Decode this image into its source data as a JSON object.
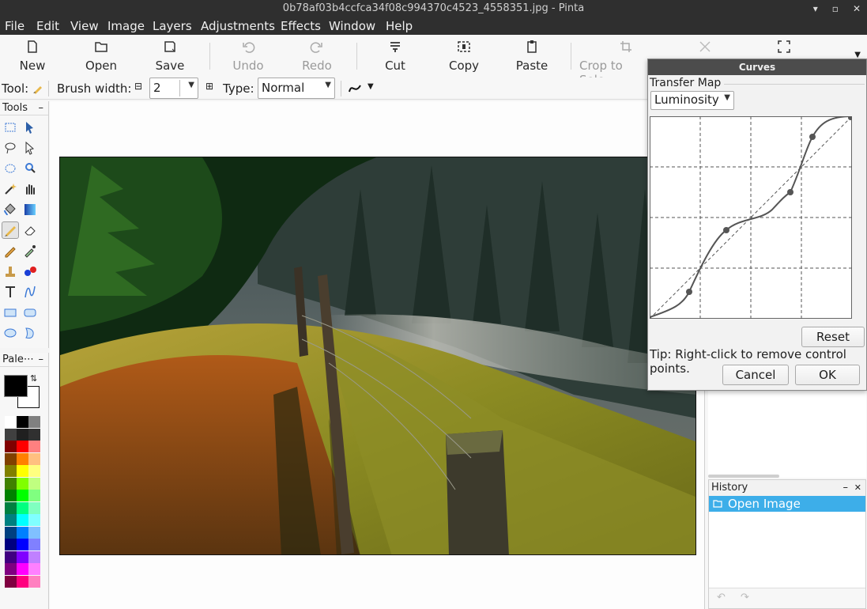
{
  "window": {
    "title": "0b78af03b4ccfca34f08c994370c4523_4558351.jpg - Pinta"
  },
  "menu": [
    {
      "label": "File"
    },
    {
      "label": "Edit"
    },
    {
      "label": "View"
    },
    {
      "label": "Image"
    },
    {
      "label": "Layers"
    },
    {
      "label": "Adjustments"
    },
    {
      "label": "Effects"
    },
    {
      "label": "Window"
    },
    {
      "label": "Help"
    }
  ],
  "toolbar": {
    "new": "New",
    "open": "Open",
    "save": "Save",
    "undo": "Undo",
    "redo": "Redo",
    "cut": "Cut",
    "copy": "Copy",
    "paste": "Paste",
    "crop": "Crop to Sele"
  },
  "tool_options": {
    "tool_label": "Tool:",
    "brush_width_label": "Brush width:",
    "brush_width_value": "2",
    "type_label": "Type:",
    "type_value": "Normal"
  },
  "panels": {
    "tools": "Tools",
    "palette": "Pale⋯",
    "history": "History",
    "minimize": "–",
    "close": "✕"
  },
  "history": {
    "items": [
      {
        "label": "Open Image"
      }
    ]
  },
  "curves_dialog": {
    "title": "Curves",
    "transfer_map_label": "Transfer Map",
    "transfer_map_value": "Luminosity",
    "reset": "Reset",
    "tip": "Tip: Right-click to remove control points.",
    "cancel": "Cancel",
    "ok": "OK"
  },
  "colors": {
    "accent": "#3daee9",
    "titlebar": "#2f2f2f",
    "primary_color": "#000000",
    "secondary_color": "#ffffff"
  },
  "palette_colors": [
    "#ffffff",
    "#000000",
    "#808080",
    "#404040",
    "#202020",
    "#303030",
    "#800000",
    "#ff0000",
    "#ff8080",
    "#804000",
    "#ff8000",
    "#ffc080",
    "#808000",
    "#ffff00",
    "#ffff80",
    "#408000",
    "#80ff00",
    "#c0ff80",
    "#008000",
    "#00ff00",
    "#80ff80",
    "#008040",
    "#00ff80",
    "#80ffc0",
    "#008080",
    "#00ffff",
    "#80ffff",
    "#004080",
    "#0080ff",
    "#80c0ff",
    "#000080",
    "#0000ff",
    "#8080ff",
    "#400080",
    "#8000ff",
    "#c080ff",
    "#800080",
    "#ff00ff",
    "#ff80ff",
    "#800040",
    "#ff0080",
    "#ff80c0"
  ]
}
